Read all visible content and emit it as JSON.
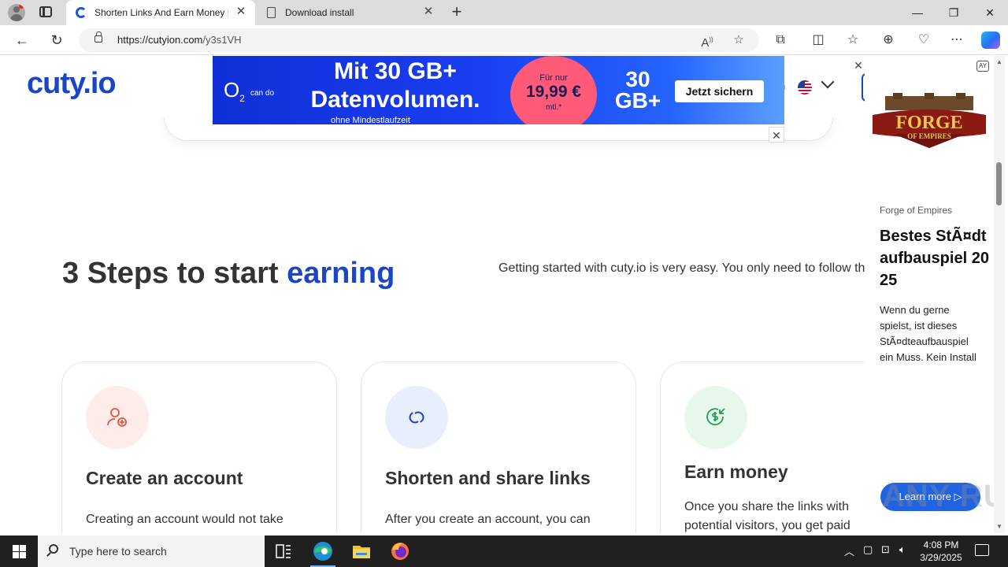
{
  "browser": {
    "tabs": [
      {
        "label": "Shorten Links And Earn Money | ",
        "active": true
      },
      {
        "label": "Download install",
        "active": false
      }
    ],
    "url_host": "https://cutyion.com",
    "url_path": "/y3s1VH"
  },
  "site": {
    "logo": "cuty.io",
    "lang_fragment": "n"
  },
  "banner_ad": {
    "brand": "O",
    "brand_sub": "2",
    "tagline": "can do",
    "headline": "Mit 30 GB+ Datenvolumen.",
    "small_print": "ohne Mindestlaufzeit",
    "price_prefix": "Für nur",
    "price": "19,99 €",
    "price_suffix": "mtl.*",
    "gb": "30 GB+",
    "cta": "Jetzt sichern"
  },
  "section": {
    "title_main": "3 Steps to start ",
    "title_accent": "earning",
    "intro": "Getting started with cuty.io is very easy. You only need to follow the steps below to get an active account that generates you passive income."
  },
  "cards": [
    {
      "title": "Create an account",
      "text": "Creating an account would not take"
    },
    {
      "title": "Shorten and share links",
      "text": "After you create an account, you can"
    },
    {
      "title": "Earn money",
      "text": "Once you share the links with potential visitors, you get paid"
    }
  ],
  "side_ad": {
    "logo_line1": "FORGE",
    "logo_line2": "OF EMPIRES",
    "brand": "Forge of Empires",
    "headline": "Bestes StÃ¤dtaufbauspiel 2025",
    "text": "Wenn du gerne spielst, ist dieses StÃ¤dteaufbauspiel ein Muss. Kein Install",
    "cta": "Learn more",
    "adchoices": "AY"
  },
  "watermark": "ANY RUN",
  "taskbar": {
    "search_placeholder": "Type here to search",
    "time": "4:08 PM",
    "date": "3/29/2025"
  },
  "colors": {
    "accent": "#1a45c7",
    "ad_blue": "#1a3df0",
    "ad_pink": "#ff5a78"
  }
}
